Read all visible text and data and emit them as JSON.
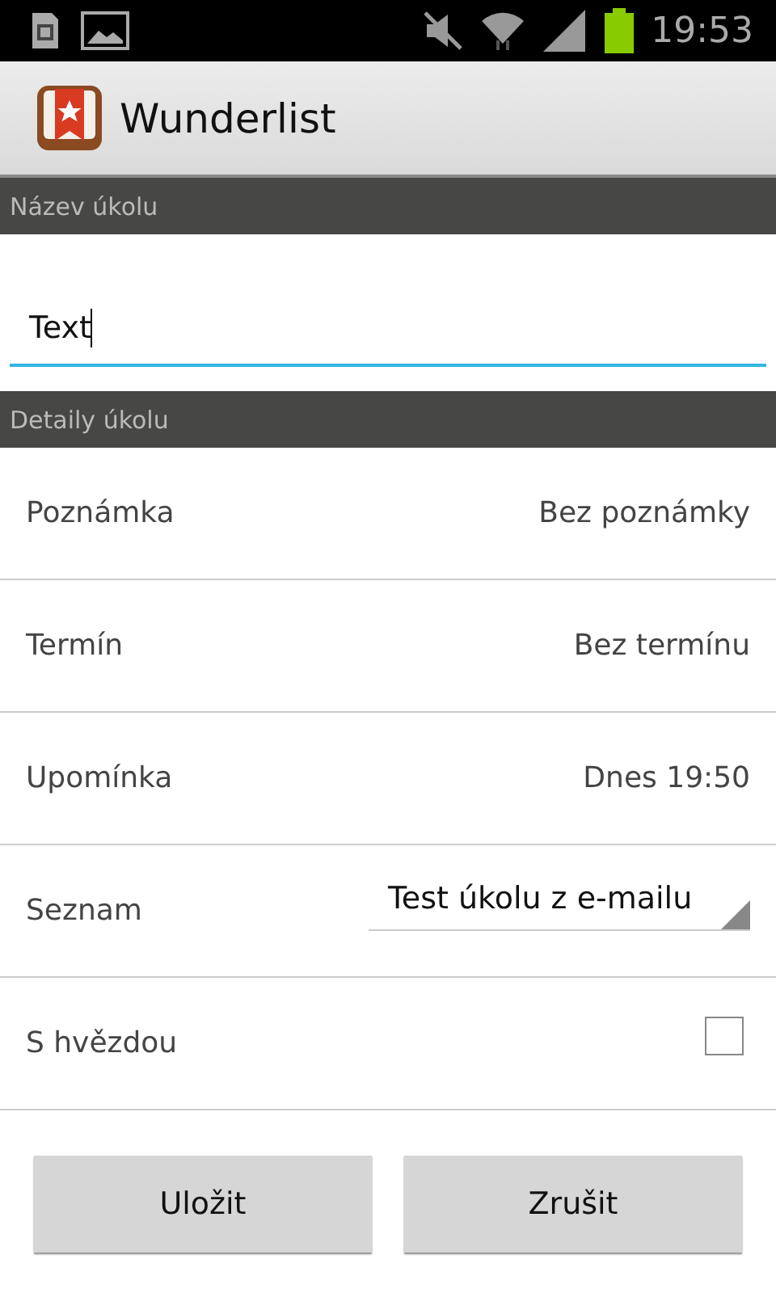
{
  "status_bar": {
    "time": "19:53"
  },
  "action_bar": {
    "title": "Wunderlist"
  },
  "sections": [
    {
      "header": "Název úkolu",
      "kind": "input",
      "value": "Text"
    },
    {
      "header": "Detaily úkolu",
      "kind": "details",
      "rows": [
        {
          "kind": "value",
          "label": "Poznámka",
          "value": "Bez poznámky"
        },
        {
          "kind": "value",
          "label": "Termín",
          "value": "Bez termínu"
        },
        {
          "kind": "value",
          "label": "Upomínka",
          "value": "Dnes 19:50"
        },
        {
          "kind": "dropdown",
          "label": "Seznam",
          "value": "Test úkolu z e-mailu"
        },
        {
          "kind": "checkbox",
          "label": "S hvězdou",
          "checked": false
        }
      ]
    }
  ],
  "buttons": [
    "Uložit",
    "Zrušit"
  ]
}
